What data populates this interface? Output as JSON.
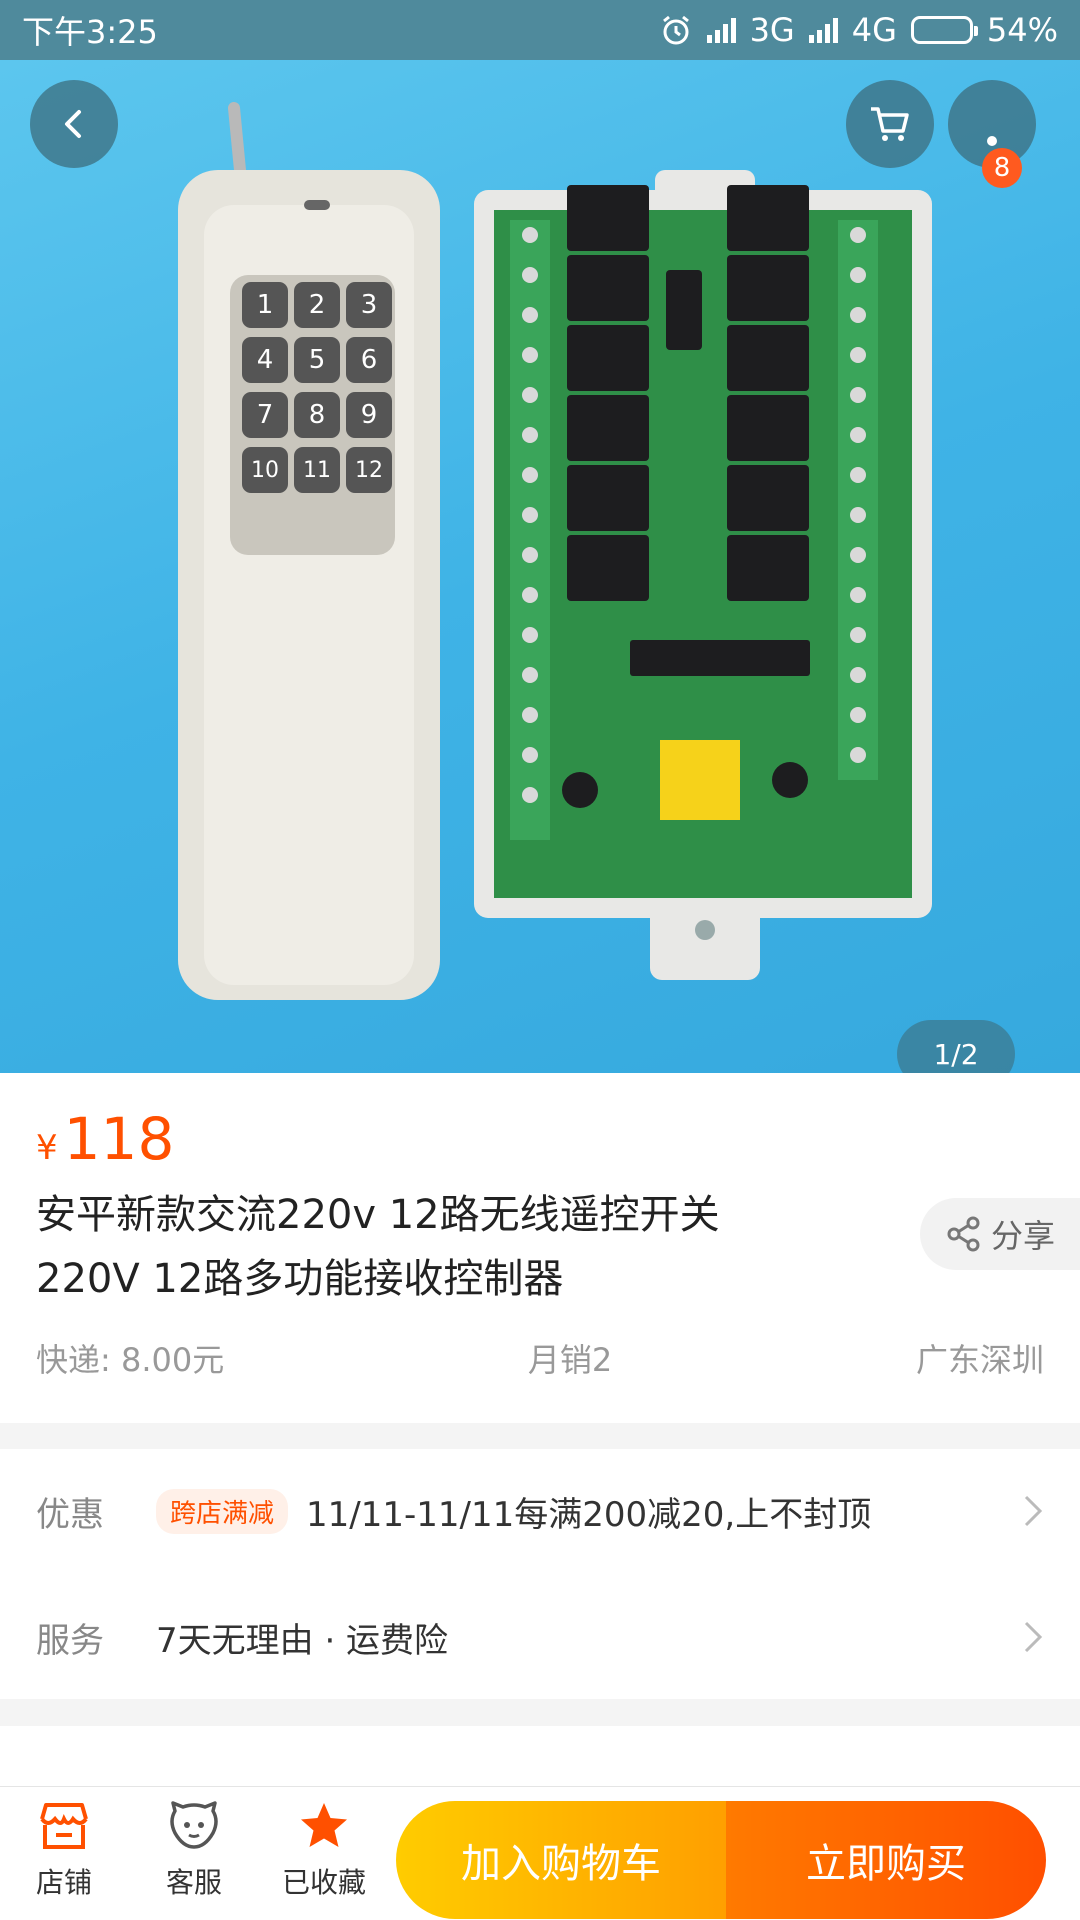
{
  "status_bar": {
    "time": "下午3:25",
    "network1": "3G",
    "network2": "4G",
    "battery": "54%"
  },
  "gallery": {
    "cart_badge": "8",
    "page_indicator": "1/2",
    "remote_keys": [
      "1",
      "2",
      "3",
      "4",
      "5",
      "6",
      "7",
      "8",
      "9",
      "10",
      "11",
      "12"
    ]
  },
  "product": {
    "currency": "¥",
    "price": "118",
    "title_line1": "安平新款交流220v  12路无线遥控开关",
    "title_line2": "220V  12路多功能接收控制器",
    "share_label": "分享",
    "shipping": "快递: 8.00元",
    "monthly_sales": "月销2",
    "location": "广东深圳"
  },
  "promo": {
    "discount_label": "优惠",
    "discount_tag": "跨店满减",
    "discount_text": "11/11-11/11每满200减20,上不封顶",
    "service_label": "服务",
    "service_text": "7天无理由  ·  运费险"
  },
  "bottom_bar": {
    "store_label": "店铺",
    "service_label": "客服",
    "favorite_label": "已收藏",
    "add_to_cart_label": "加入购物车",
    "buy_now_label": "立即购买"
  },
  "colors": {
    "accent": "#ff5000",
    "status_bar": "#4f8a9c",
    "hero_bg": "#3fb3e6"
  }
}
